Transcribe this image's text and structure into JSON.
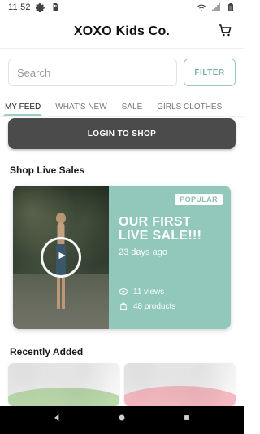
{
  "status_bar": {
    "time": "11:52",
    "icons_left": [
      "gear-icon",
      "sd-card-icon"
    ],
    "icons_right": [
      "wifi-icon",
      "signal-icon",
      "battery-icon"
    ]
  },
  "header": {
    "title": "XOXO Kids Co.",
    "cart_icon": "cart-icon"
  },
  "search": {
    "placeholder": "Search",
    "value": ""
  },
  "filter": {
    "label": "FILTER"
  },
  "tabs": [
    {
      "label": "MY FEED",
      "active": true
    },
    {
      "label": "WHAT'S NEW",
      "active": false
    },
    {
      "label": "SALE",
      "active": false
    },
    {
      "label": "GIRLS CLOTHES",
      "active": false
    }
  ],
  "login": {
    "label": "LOGIN TO SHOP"
  },
  "sections": {
    "live_title": "Shop Live Sales",
    "recent_title": "Recently Added"
  },
  "live_card": {
    "badge": "POPULAR",
    "title": "OUR FIRST LIVE SALE!!!",
    "time_ago": "23 days ago",
    "views": "11 views",
    "products": "48 products",
    "accent": "#92c8bb"
  },
  "nav_bar": {
    "back_icon": "back-icon",
    "home_icon": "home-icon",
    "recents_icon": "recents-icon"
  }
}
